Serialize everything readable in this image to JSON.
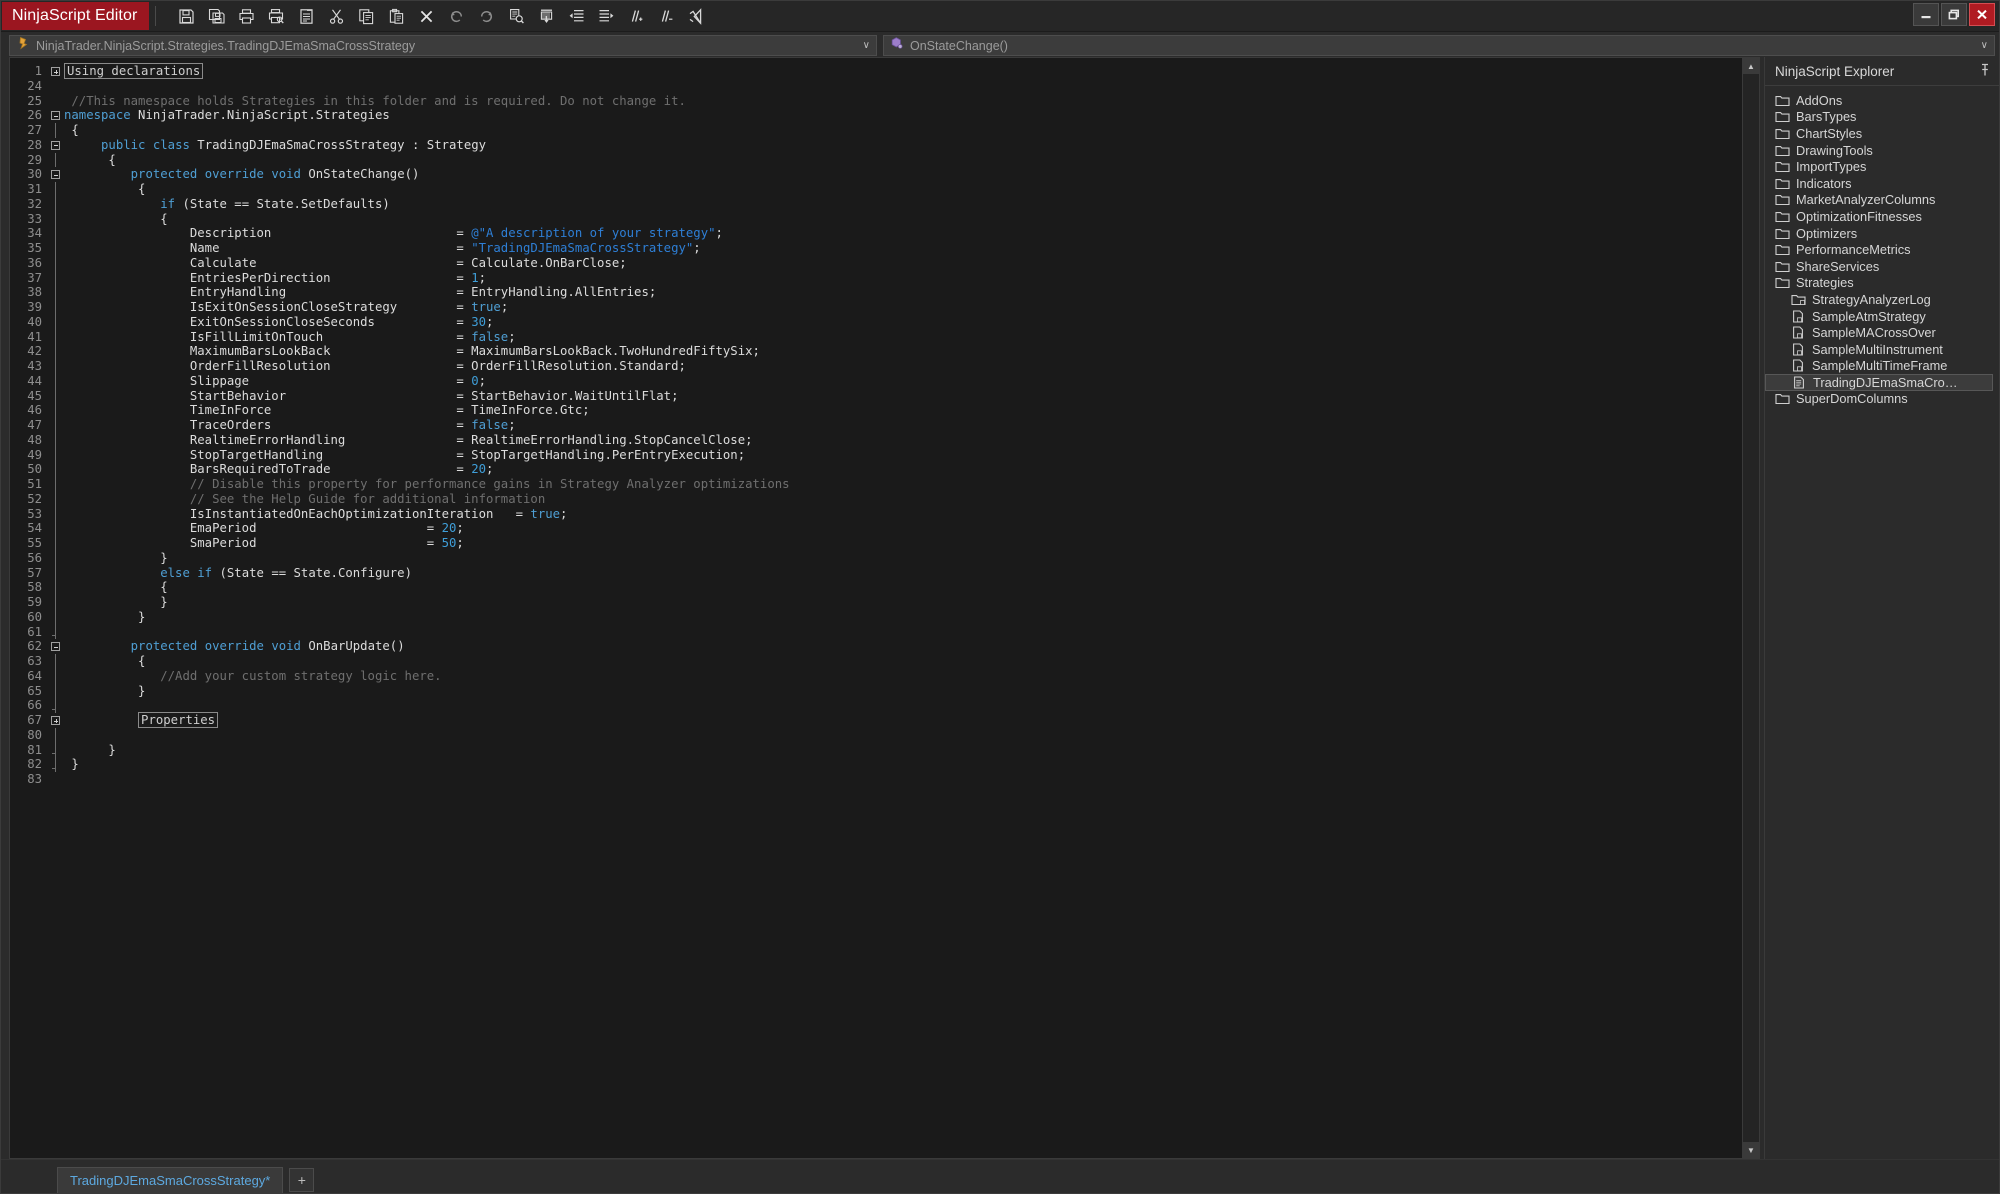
{
  "window": {
    "app_badge": "NinjaScript Editor",
    "minimize_label": "Minimize",
    "maximize_label": "Restore",
    "close_label": "Close"
  },
  "toolbar": {
    "buttons": [
      {
        "name": "save-icon",
        "tip": "Save"
      },
      {
        "name": "save-all-icon",
        "tip": "Save All"
      },
      {
        "name": "print-icon",
        "tip": "Print"
      },
      {
        "name": "print-preview-icon",
        "tip": "Print Preview"
      },
      {
        "name": "new-file-icon",
        "tip": "New"
      },
      {
        "name": "cut-icon",
        "tip": "Cut"
      },
      {
        "name": "copy-icon",
        "tip": "Copy"
      },
      {
        "name": "paste-icon",
        "tip": "Paste"
      },
      {
        "name": "delete-icon",
        "tip": "Delete"
      },
      {
        "name": "undo-icon",
        "tip": "Undo"
      },
      {
        "name": "redo-icon",
        "tip": "Redo"
      },
      {
        "name": "find-icon",
        "tip": "Find"
      },
      {
        "name": "compile-icon",
        "tip": "Compile"
      },
      {
        "name": "outdent-icon",
        "tip": "Decrease Indent"
      },
      {
        "name": "indent-icon",
        "tip": "Increase Indent"
      },
      {
        "name": "comment-icon",
        "tip": "Comment Selection"
      },
      {
        "name": "uncomment-icon",
        "tip": "Uncomment Selection"
      },
      {
        "name": "visual-studio-icon",
        "tip": "Open in Visual Studio"
      }
    ]
  },
  "navbar": {
    "type_combo": {
      "value": "NinjaTrader.NinjaScript.Strategies.TradingDJEmaSmaCrossStrategy",
      "icon": "class-icon",
      "arrow": "∨"
    },
    "member_combo": {
      "value": "OnStateChange()",
      "icon": "method-icon",
      "arrow": "∨"
    }
  },
  "editor": {
    "lines": [
      {
        "num": "1",
        "fold": "plus",
        "indent": 0,
        "tokens": [
          {
            "t": "Using declarations",
            "c": "chip"
          }
        ]
      },
      {
        "num": "24",
        "fold": "none",
        "indent": 0,
        "tokens": []
      },
      {
        "num": "25",
        "fold": "none",
        "indent": 0,
        "tokens": [
          {
            "t": " //This namespace holds Strategies in this folder and is required. Do not change it.",
            "c": "cmt"
          }
        ]
      },
      {
        "num": "26",
        "fold": "minus",
        "indent": 0,
        "tokens": [
          {
            "t": "namespace",
            "c": "kw"
          },
          {
            "t": " NinjaTrader.NinjaScript.Strategies",
            "c": "pln"
          }
        ]
      },
      {
        "num": "27",
        "fold": "bar",
        "indent": 0,
        "tokens": [
          {
            "t": " {",
            "c": "pln"
          }
        ]
      },
      {
        "num": "28",
        "fold": "minus",
        "indent": 0,
        "tokens": [
          {
            "t": "     ",
            "c": "pln"
          },
          {
            "t": "public",
            "c": "kw"
          },
          {
            "t": " ",
            "c": "pln"
          },
          {
            "t": "class",
            "c": "kw"
          },
          {
            "t": " TradingDJEmaSmaCrossStrategy : Strategy",
            "c": "pln"
          }
        ]
      },
      {
        "num": "29",
        "fold": "bar",
        "indent": 0,
        "tokens": [
          {
            "t": "      {",
            "c": "pln"
          }
        ]
      },
      {
        "num": "30",
        "fold": "minus",
        "indent": 0,
        "tokens": [
          {
            "t": "         ",
            "c": "pln"
          },
          {
            "t": "protected",
            "c": "kw"
          },
          {
            "t": " ",
            "c": "pln"
          },
          {
            "t": "override",
            "c": "kw"
          },
          {
            "t": " ",
            "c": "pln"
          },
          {
            "t": "void",
            "c": "kw"
          },
          {
            "t": " OnStateChange()",
            "c": "pln"
          }
        ]
      },
      {
        "num": "31",
        "fold": "bar",
        "indent": 0,
        "tokens": [
          {
            "t": "          {",
            "c": "pln"
          }
        ]
      },
      {
        "num": "32",
        "fold": "bar",
        "indent": 0,
        "tokens": [
          {
            "t": "             ",
            "c": "pln"
          },
          {
            "t": "if",
            "c": "kw"
          },
          {
            "t": " (State == State.SetDefaults)",
            "c": "pln"
          }
        ]
      },
      {
        "num": "33",
        "fold": "bar",
        "indent": 0,
        "tokens": [
          {
            "t": "             {",
            "c": "pln"
          }
        ]
      },
      {
        "num": "34",
        "fold": "bar",
        "indent": 0,
        "tokens": [
          {
            "t": "                 Description                         = ",
            "c": "pln"
          },
          {
            "t": "@\"A description of your strategy\"",
            "c": "str"
          },
          {
            "t": ";",
            "c": "pln"
          }
        ]
      },
      {
        "num": "35",
        "fold": "bar",
        "indent": 0,
        "tokens": [
          {
            "t": "                 Name                                = ",
            "c": "pln"
          },
          {
            "t": "\"TradingDJEmaSmaCrossStrategy\"",
            "c": "str"
          },
          {
            "t": ";",
            "c": "pln"
          }
        ]
      },
      {
        "num": "36",
        "fold": "bar",
        "indent": 0,
        "tokens": [
          {
            "t": "                 Calculate                           = Calculate.OnBarClose;",
            "c": "pln"
          }
        ]
      },
      {
        "num": "37",
        "fold": "bar",
        "indent": 0,
        "tokens": [
          {
            "t": "                 EntriesPerDirection                 = ",
            "c": "pln"
          },
          {
            "t": "1",
            "c": "num"
          },
          {
            "t": ";",
            "c": "pln"
          }
        ]
      },
      {
        "num": "38",
        "fold": "bar",
        "indent": 0,
        "tokens": [
          {
            "t": "                 EntryHandling                       = EntryHandling.AllEntries;",
            "c": "pln"
          }
        ]
      },
      {
        "num": "39",
        "fold": "bar",
        "indent": 0,
        "tokens": [
          {
            "t": "                 IsExitOnSessionCloseStrategy        = ",
            "c": "pln"
          },
          {
            "t": "true",
            "c": "kw"
          },
          {
            "t": ";",
            "c": "pln"
          }
        ]
      },
      {
        "num": "40",
        "fold": "bar",
        "indent": 0,
        "tokens": [
          {
            "t": "                 ExitOnSessionCloseSeconds           = ",
            "c": "pln"
          },
          {
            "t": "30",
            "c": "num"
          },
          {
            "t": ";",
            "c": "pln"
          }
        ]
      },
      {
        "num": "41",
        "fold": "bar",
        "indent": 0,
        "tokens": [
          {
            "t": "                 IsFillLimitOnTouch                  = ",
            "c": "pln"
          },
          {
            "t": "false",
            "c": "kw"
          },
          {
            "t": ";",
            "c": "pln"
          }
        ]
      },
      {
        "num": "42",
        "fold": "bar",
        "indent": 0,
        "tokens": [
          {
            "t": "                 MaximumBarsLookBack                 = MaximumBarsLookBack.TwoHundredFiftySix;",
            "c": "pln"
          }
        ]
      },
      {
        "num": "43",
        "fold": "bar",
        "indent": 0,
        "tokens": [
          {
            "t": "                 OrderFillResolution                 = OrderFillResolution.Standard;",
            "c": "pln"
          }
        ]
      },
      {
        "num": "44",
        "fold": "bar",
        "indent": 0,
        "tokens": [
          {
            "t": "                 Slippage                            = ",
            "c": "pln"
          },
          {
            "t": "0",
            "c": "num"
          },
          {
            "t": ";",
            "c": "pln"
          }
        ]
      },
      {
        "num": "45",
        "fold": "bar",
        "indent": 0,
        "tokens": [
          {
            "t": "                 StartBehavior                       = StartBehavior.WaitUntilFlat;",
            "c": "pln"
          }
        ]
      },
      {
        "num": "46",
        "fold": "bar",
        "indent": 0,
        "tokens": [
          {
            "t": "                 TimeInForce                         = TimeInForce.Gtc;",
            "c": "pln"
          }
        ]
      },
      {
        "num": "47",
        "fold": "bar",
        "indent": 0,
        "tokens": [
          {
            "t": "                 TraceOrders                         = ",
            "c": "pln"
          },
          {
            "t": "false",
            "c": "kw"
          },
          {
            "t": ";",
            "c": "pln"
          }
        ]
      },
      {
        "num": "48",
        "fold": "bar",
        "indent": 0,
        "tokens": [
          {
            "t": "                 RealtimeErrorHandling               = RealtimeErrorHandling.StopCancelClose;",
            "c": "pln"
          }
        ]
      },
      {
        "num": "49",
        "fold": "bar",
        "indent": 0,
        "tokens": [
          {
            "t": "                 StopTargetHandling                  = StopTargetHandling.PerEntryExecution;",
            "c": "pln"
          }
        ]
      },
      {
        "num": "50",
        "fold": "bar",
        "indent": 0,
        "tokens": [
          {
            "t": "                 BarsRequiredToTrade                 = ",
            "c": "pln"
          },
          {
            "t": "20",
            "c": "num"
          },
          {
            "t": ";",
            "c": "pln"
          }
        ]
      },
      {
        "num": "51",
        "fold": "bar",
        "indent": 0,
        "tokens": [
          {
            "t": "                 // Disable this property for performance gains in Strategy Analyzer optimizations",
            "c": "cmt"
          }
        ]
      },
      {
        "num": "52",
        "fold": "bar",
        "indent": 0,
        "tokens": [
          {
            "t": "                 // See the Help Guide for additional information",
            "c": "cmt"
          }
        ]
      },
      {
        "num": "53",
        "fold": "bar",
        "indent": 0,
        "tokens": [
          {
            "t": "                 IsInstantiatedOnEachOptimizationIteration   = ",
            "c": "pln"
          },
          {
            "t": "true",
            "c": "kw"
          },
          {
            "t": ";",
            "c": "pln"
          }
        ]
      },
      {
        "num": "54",
        "fold": "bar",
        "indent": 0,
        "tokens": [
          {
            "t": "                 EmaPeriod                       = ",
            "c": "pln"
          },
          {
            "t": "20",
            "c": "num"
          },
          {
            "t": ";",
            "c": "pln"
          }
        ]
      },
      {
        "num": "55",
        "fold": "bar",
        "indent": 0,
        "tokens": [
          {
            "t": "                 SmaPeriod                       = ",
            "c": "pln"
          },
          {
            "t": "50",
            "c": "num"
          },
          {
            "t": ";",
            "c": "pln"
          }
        ]
      },
      {
        "num": "56",
        "fold": "bar",
        "indent": 0,
        "tokens": [
          {
            "t": "             }",
            "c": "pln"
          }
        ]
      },
      {
        "num": "57",
        "fold": "bar",
        "indent": 0,
        "tokens": [
          {
            "t": "             ",
            "c": "pln"
          },
          {
            "t": "else",
            "c": "kw"
          },
          {
            "t": " ",
            "c": "pln"
          },
          {
            "t": "if",
            "c": "kw"
          },
          {
            "t": " (State == State.Configure)",
            "c": "pln"
          }
        ]
      },
      {
        "num": "58",
        "fold": "bar",
        "indent": 0,
        "tokens": [
          {
            "t": "             {",
            "c": "pln"
          }
        ]
      },
      {
        "num": "59",
        "fold": "bar",
        "indent": 0,
        "tokens": [
          {
            "t": "             }",
            "c": "pln"
          }
        ]
      },
      {
        "num": "60",
        "fold": "bar",
        "indent": 0,
        "tokens": [
          {
            "t": "          }",
            "c": "pln"
          }
        ]
      },
      {
        "num": "61",
        "fold": "endbar",
        "indent": 0,
        "tokens": []
      },
      {
        "num": "62",
        "fold": "minus",
        "indent": 0,
        "tokens": [
          {
            "t": "         ",
            "c": "pln"
          },
          {
            "t": "protected",
            "c": "kw"
          },
          {
            "t": " ",
            "c": "pln"
          },
          {
            "t": "override",
            "c": "kw"
          },
          {
            "t": " ",
            "c": "pln"
          },
          {
            "t": "void",
            "c": "kw"
          },
          {
            "t": " OnBarUpdate()",
            "c": "pln"
          }
        ]
      },
      {
        "num": "63",
        "fold": "bar",
        "indent": 0,
        "tokens": [
          {
            "t": "          {",
            "c": "pln"
          }
        ]
      },
      {
        "num": "64",
        "fold": "bar",
        "indent": 0,
        "tokens": [
          {
            "t": "             //Add your custom strategy logic here.",
            "c": "cmt"
          }
        ]
      },
      {
        "num": "65",
        "fold": "bar",
        "indent": 0,
        "tokens": [
          {
            "t": "          }",
            "c": "pln"
          }
        ]
      },
      {
        "num": "66",
        "fold": "endbar",
        "indent": 0,
        "tokens": []
      },
      {
        "num": "67",
        "fold": "plus",
        "indent": 0,
        "tokens": [
          {
            "t": "          ",
            "c": "pln"
          },
          {
            "t": "Properties",
            "c": "chip"
          }
        ]
      },
      {
        "num": "80",
        "fold": "bar",
        "indent": 0,
        "tokens": []
      },
      {
        "num": "81",
        "fold": "endbar",
        "indent": 0,
        "tokens": [
          {
            "t": "      }",
            "c": "pln"
          }
        ]
      },
      {
        "num": "82",
        "fold": "endbar",
        "indent": 0,
        "tokens": [
          {
            "t": " }",
            "c": "pln"
          }
        ]
      },
      {
        "num": "83",
        "fold": "none",
        "indent": 0,
        "tokens": []
      }
    ],
    "scroll": {
      "up_arrow": "▲",
      "down_arrow": "▼"
    }
  },
  "explorer": {
    "title": "NinjaScript Explorer",
    "pin_icon": "pin-icon",
    "items": [
      {
        "label": "AddOns",
        "type": "folder",
        "depth": 0,
        "selected": false
      },
      {
        "label": "BarsTypes",
        "type": "folder",
        "depth": 0,
        "selected": false
      },
      {
        "label": "ChartStyles",
        "type": "folder",
        "depth": 0,
        "selected": false
      },
      {
        "label": "DrawingTools",
        "type": "folder",
        "depth": 0,
        "selected": false
      },
      {
        "label": "ImportTypes",
        "type": "folder",
        "depth": 0,
        "selected": false
      },
      {
        "label": "Indicators",
        "type": "folder",
        "depth": 0,
        "selected": false
      },
      {
        "label": "MarketAnalyzerColumns",
        "type": "folder",
        "depth": 0,
        "selected": false
      },
      {
        "label": "OptimizationFitnesses",
        "type": "folder",
        "depth": 0,
        "selected": false
      },
      {
        "label": "Optimizers",
        "type": "folder",
        "depth": 0,
        "selected": false
      },
      {
        "label": "PerformanceMetrics",
        "type": "folder",
        "depth": 0,
        "selected": false
      },
      {
        "label": "ShareServices",
        "type": "folder",
        "depth": 0,
        "selected": false
      },
      {
        "label": "Strategies",
        "type": "folder-open",
        "depth": 0,
        "selected": false
      },
      {
        "label": "StrategyAnalyzerLog",
        "type": "folder-lock",
        "depth": 1,
        "selected": false
      },
      {
        "label": "SampleAtmStrategy",
        "type": "file-lock",
        "depth": 1,
        "selected": false
      },
      {
        "label": "SampleMACrossOver",
        "type": "file-lock",
        "depth": 1,
        "selected": false
      },
      {
        "label": "SampleMultiInstrument",
        "type": "file-lock",
        "depth": 1,
        "selected": false
      },
      {
        "label": "SampleMultiTimeFrame",
        "type": "file-lock",
        "depth": 1,
        "selected": false
      },
      {
        "label": "TradingDJEmaSmaCro…",
        "type": "file",
        "depth": 1,
        "selected": true
      },
      {
        "label": "SuperDomColumns",
        "type": "folder",
        "depth": 0,
        "selected": false
      }
    ]
  },
  "tabbar": {
    "tabs": [
      {
        "label": "TradingDJEmaSmaCrossStrategy*",
        "active": true
      }
    ],
    "add_label": "+"
  }
}
